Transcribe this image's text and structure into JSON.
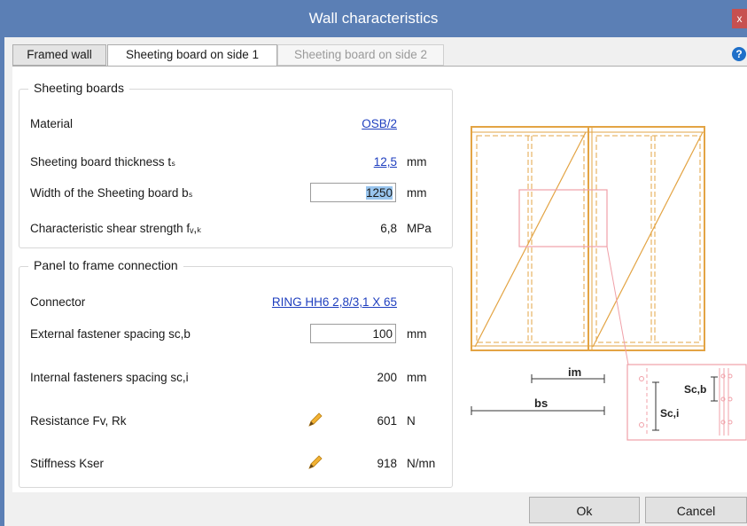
{
  "window": {
    "title": "Wall characteristics",
    "close_glyph": "x"
  },
  "tabs": [
    {
      "label": "Framed wall",
      "state": "normal"
    },
    {
      "label": "Sheeting board on side 1",
      "state": "active"
    },
    {
      "label": "Sheeting board on side 2",
      "state": "disabled"
    }
  ],
  "help_glyph": "?",
  "sheeting": {
    "title": "Sheeting boards",
    "rows": [
      {
        "label": "Material",
        "value": "OSB/2",
        "unit": ""
      },
      {
        "label": "Sheeting board thickness tₛ",
        "value": "12,5",
        "unit": "mm"
      },
      {
        "label": "Width of the Sheeting board bₛ",
        "value": "1250",
        "unit": "mm"
      },
      {
        "label": "Characteristic shear strength fᵥ,ₖ",
        "value": "6,8",
        "unit": "MPa"
      }
    ]
  },
  "connection": {
    "title": "Panel to frame connection",
    "rows": [
      {
        "label": "Connector",
        "value": "RING HH6 2,8/3,1 X 65",
        "unit": ""
      },
      {
        "label": "External fastener spacing sc,b",
        "value": "100",
        "unit": "mm"
      },
      {
        "label": "Internal fasteners spacing sc,i",
        "value": "200",
        "unit": "mm"
      },
      {
        "label": "Resistance Fv, Rk",
        "value": "601",
        "unit": "N"
      },
      {
        "label": "Stiffness Kser",
        "value": "918",
        "unit": "N/mn"
      }
    ]
  },
  "diagram": {
    "labels": {
      "im": "im",
      "bs": "bs",
      "scb": "Sc,b",
      "sci": "Sc,i"
    },
    "colors": {
      "frame": "#e3a444",
      "detail": "#f0a0a8"
    }
  },
  "buttons": {
    "ok": "Ok",
    "cancel": "Cancel"
  }
}
